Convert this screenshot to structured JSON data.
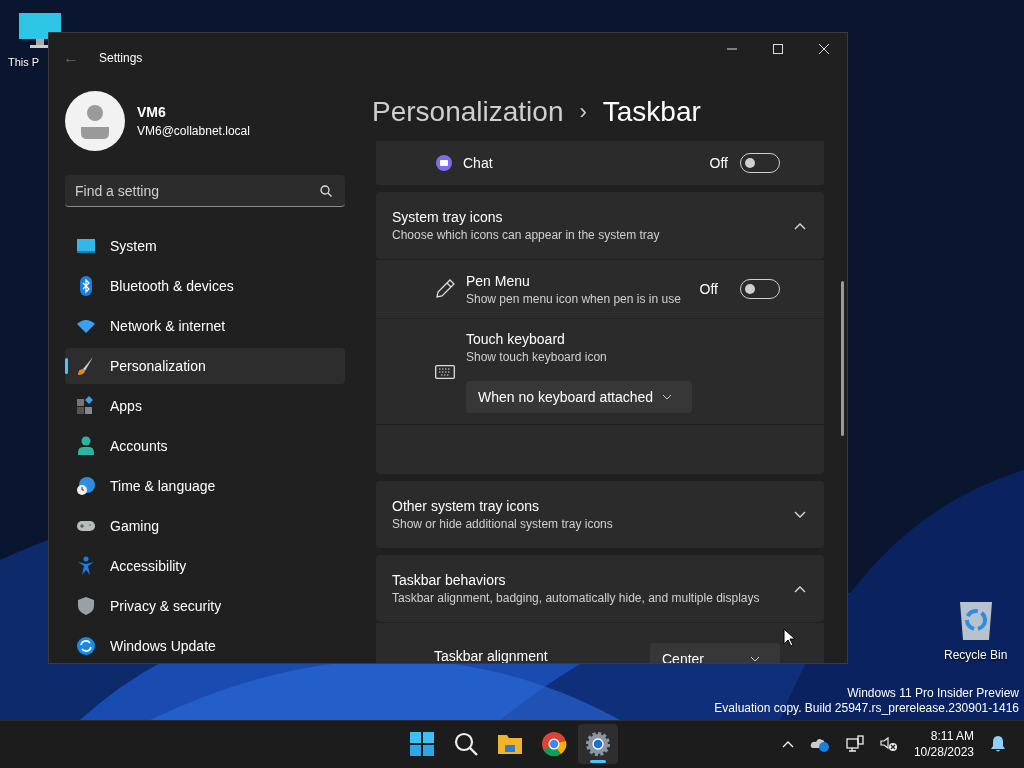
{
  "desktop_icons": [
    {
      "label": "This P"
    },
    {
      "label": "Recycle Bin"
    }
  ],
  "window": {
    "title": "Settings",
    "back": "←"
  },
  "profile": {
    "name": "VM6",
    "email": "VM6@collabnet.local"
  },
  "search": {
    "placeholder": "Find a setting"
  },
  "sidebar": {
    "items": [
      {
        "label": "System",
        "selected": false
      },
      {
        "label": "Bluetooth & devices",
        "selected": false
      },
      {
        "label": "Network & internet",
        "selected": false
      },
      {
        "label": "Personalization",
        "selected": true
      },
      {
        "label": "Apps",
        "selected": false
      },
      {
        "label": "Accounts",
        "selected": false
      },
      {
        "label": "Time & language",
        "selected": false
      },
      {
        "label": "Gaming",
        "selected": false
      },
      {
        "label": "Accessibility",
        "selected": false
      },
      {
        "label": "Privacy & security",
        "selected": false
      },
      {
        "label": "Windows Update",
        "selected": false
      }
    ]
  },
  "breadcrumb": {
    "parent": "Personalization",
    "separator": "›",
    "current": "Taskbar"
  },
  "sections": [
    {
      "kind": "toggle",
      "label": "Chat",
      "state_text": "Off",
      "on": false
    },
    {
      "kind": "group",
      "title": "System tray icons",
      "subtitle": "Choose which icons can appear in the system tray",
      "expanded": true,
      "children": [
        {
          "kind": "toggle",
          "label": "Pen Menu",
          "description": "Show pen menu icon when pen is in use",
          "state_text": "Off",
          "on": false
        },
        {
          "kind": "dropdown",
          "label": "Touch keyboard",
          "description": "Show touch keyboard icon",
          "value": "When no keyboard attached"
        },
        {
          "kind": "blank"
        }
      ]
    },
    {
      "kind": "group",
      "title": "Other system tray icons",
      "subtitle": "Show or hide additional system tray icons",
      "expanded": false
    },
    {
      "kind": "group",
      "title": "Taskbar behaviors",
      "subtitle": "Taskbar alignment, badging, automatically hide, and multiple displays",
      "expanded": true,
      "children": [
        {
          "kind": "select",
          "label": "Taskbar alignment",
          "value": "Center"
        }
      ]
    }
  ],
  "watermark": [
    "Windows 11 Pro Insider Preview",
    "Evaluation copy. Build 25947.rs_prerelease.230901-1416"
  ],
  "taskbar": {
    "apps": [
      {
        "selected": false
      },
      {
        "selected": false
      },
      {
        "selected": false
      },
      {
        "selected": false
      },
      {
        "selected": true
      }
    ],
    "time": "8:11 AM",
    "date": "10/28/2023"
  }
}
